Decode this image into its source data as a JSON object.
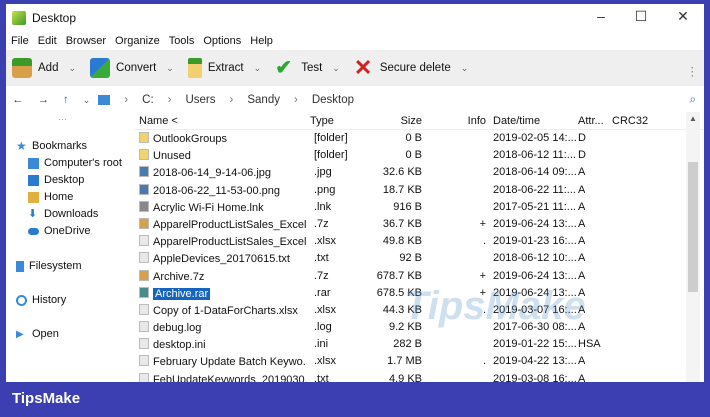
{
  "window": {
    "title": "Desktop",
    "minimize": "–",
    "maximize": "☐",
    "close": "✕"
  },
  "menu": [
    "File",
    "Edit",
    "Browser",
    "Organize",
    "Tools",
    "Options",
    "Help"
  ],
  "toolbar": {
    "add": "Add",
    "convert": "Convert",
    "extract": "Extract",
    "test": "Test",
    "secure_delete": "Secure delete",
    "more": "⋮"
  },
  "address": {
    "path": [
      "C:",
      "Users",
      "Sandy",
      "Desktop"
    ]
  },
  "sidebar": {
    "more": "···",
    "items": [
      "Bookmarks",
      "Computer's root",
      "Desktop",
      "Home",
      "Downloads",
      "OneDrive",
      "Filesystem",
      "History",
      "Open"
    ]
  },
  "columns": {
    "name": "Name <",
    "type": "Type",
    "size": "Size",
    "info": "Info",
    "date": "Date/time",
    "attr": "Attr...",
    "crc": "CRC32"
  },
  "files": [
    {
      "name": "OutlookGroups",
      "type": "[folder]",
      "size": "0 B",
      "info": "",
      "date": "2019-02-05 14:...",
      "attr": "D",
      "icon": "folder"
    },
    {
      "name": "Unused",
      "type": "[folder]",
      "size": "0 B",
      "info": "",
      "date": "2018-06-12 11:...",
      "attr": "D",
      "icon": "folder"
    },
    {
      "name": "2018-06-14_9-14-06.jpg",
      "type": ".jpg",
      "size": "32.6 KB",
      "info": "",
      "date": "2018-06-14 09:...",
      "attr": "A",
      "icon": "image"
    },
    {
      "name": "2018-06-22_11-53-00.png",
      "type": ".png",
      "size": "18.7 KB",
      "info": "",
      "date": "2018-06-22 11:...",
      "attr": "A",
      "icon": "image"
    },
    {
      "name": "Acrylic Wi-Fi Home.lnk",
      "type": ".lnk",
      "size": "916 B",
      "info": "",
      "date": "2017-05-21 11:...",
      "attr": "A",
      "icon": "link"
    },
    {
      "name": "ApparelProductListSales_Excel...",
      "type": ".7z",
      "size": "36.7 KB",
      "info": "+",
      "date": "2019-06-24 13:...",
      "attr": "A",
      "icon": "archive"
    },
    {
      "name": "ApparelProductListSales_Excel...",
      "type": ".xlsx",
      "size": "49.8 KB",
      "info": ".",
      "date": "2019-01-23 16:...",
      "attr": "A",
      "icon": "file"
    },
    {
      "name": "AppleDevices_20170615.txt",
      "type": ".txt",
      "size": "92 B",
      "info": "",
      "date": "2018-06-12 10:...",
      "attr": "A",
      "icon": "file"
    },
    {
      "name": "Archive.7z",
      "type": ".7z",
      "size": "678.7 KB",
      "info": "+",
      "date": "2019-06-24 13:...",
      "attr": "A",
      "icon": "archive"
    },
    {
      "name": "Archive.rar",
      "type": ".rar",
      "size": "678.5 KB",
      "info": "+",
      "date": "2019-06-24 13:...",
      "attr": "A",
      "icon": "rar",
      "selected": true
    },
    {
      "name": "Copy of 1-DataForCharts.xlsx",
      "type": ".xlsx",
      "size": "44.3 KB",
      "info": ".",
      "date": "2019-03-07 16:...",
      "attr": "A",
      "icon": "file"
    },
    {
      "name": "debug.log",
      "type": ".log",
      "size": "9.2 KB",
      "info": "",
      "date": "2017-06-30 08:...",
      "attr": "A",
      "icon": "file"
    },
    {
      "name": "desktop.ini",
      "type": ".ini",
      "size": "282 B",
      "info": "",
      "date": "2019-01-22 15:...",
      "attr": "HSA",
      "icon": "file"
    },
    {
      "name": "February Update Batch Keywo...",
      "type": ".xlsx",
      "size": "1.7 MB",
      "info": ".",
      "date": "2019-04-22 13:...",
      "attr": "A",
      "icon": "file"
    },
    {
      "name": "FebUpdateKeywords_2019030...",
      "type": ".txt",
      "size": "4.9 KB",
      "info": "",
      "date": "2019-03-08 16:...",
      "attr": "A",
      "icon": "file"
    }
  ],
  "watermark": "TipsMake",
  "banner": "TipsMake"
}
